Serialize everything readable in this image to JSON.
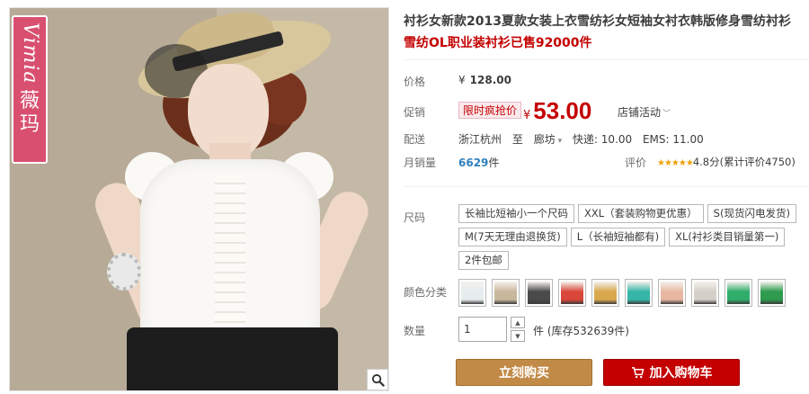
{
  "brand": {
    "latin": "Vimia",
    "chinese": "薇玛"
  },
  "title": {
    "line1": "衬衫女新款2013夏款女装上衣雪纺衫女短袖女衬衣韩版修身雪纺衬衫",
    "line2": "雪纺OL职业装衬衫已售92000件"
  },
  "price": {
    "label": "价格",
    "currency": "¥",
    "value": "128.00"
  },
  "promo": {
    "label": "促销",
    "tag": "限时疯抢价",
    "currency": "¥",
    "value": "53.00",
    "shop_event": "店铺活动"
  },
  "shipping": {
    "label": "配送",
    "from": "浙江杭州",
    "to_word": "至",
    "to": "廊坊",
    "express": "快递: 10.00",
    "ems": "EMS: 11.00"
  },
  "sales": {
    "label": "月销量",
    "count": "6629",
    "unit": "件"
  },
  "rating": {
    "label": "评价",
    "stars": "★★★★★",
    "score": "4.8分",
    "review": "(累计评价4750)"
  },
  "sizes": {
    "label": "尺码",
    "options": [
      "长袖比短袖小一个尺码",
      "XXL（套装购物更优惠）",
      "S(现货闪电发货)",
      "M(7天无理由退换货)",
      "L（长袖短袖都有)",
      "XL(衬衫类目销量第一)",
      "2件包邮"
    ]
  },
  "colors": {
    "label": "颜色分类",
    "swatches": [
      "#e7ecef",
      "#c9b79c",
      "#4a4a4a",
      "#d9463a",
      "#d9a84e",
      "#35b6a7",
      "#e7b7a2",
      "#d5cfc9",
      "#2fae6b",
      "#2e9b4f"
    ]
  },
  "quantity": {
    "label": "数量",
    "value": "1",
    "stock": "件 (库存532639件)"
  },
  "actions": {
    "buy": "立刻购买",
    "cart": "加入购物车"
  }
}
